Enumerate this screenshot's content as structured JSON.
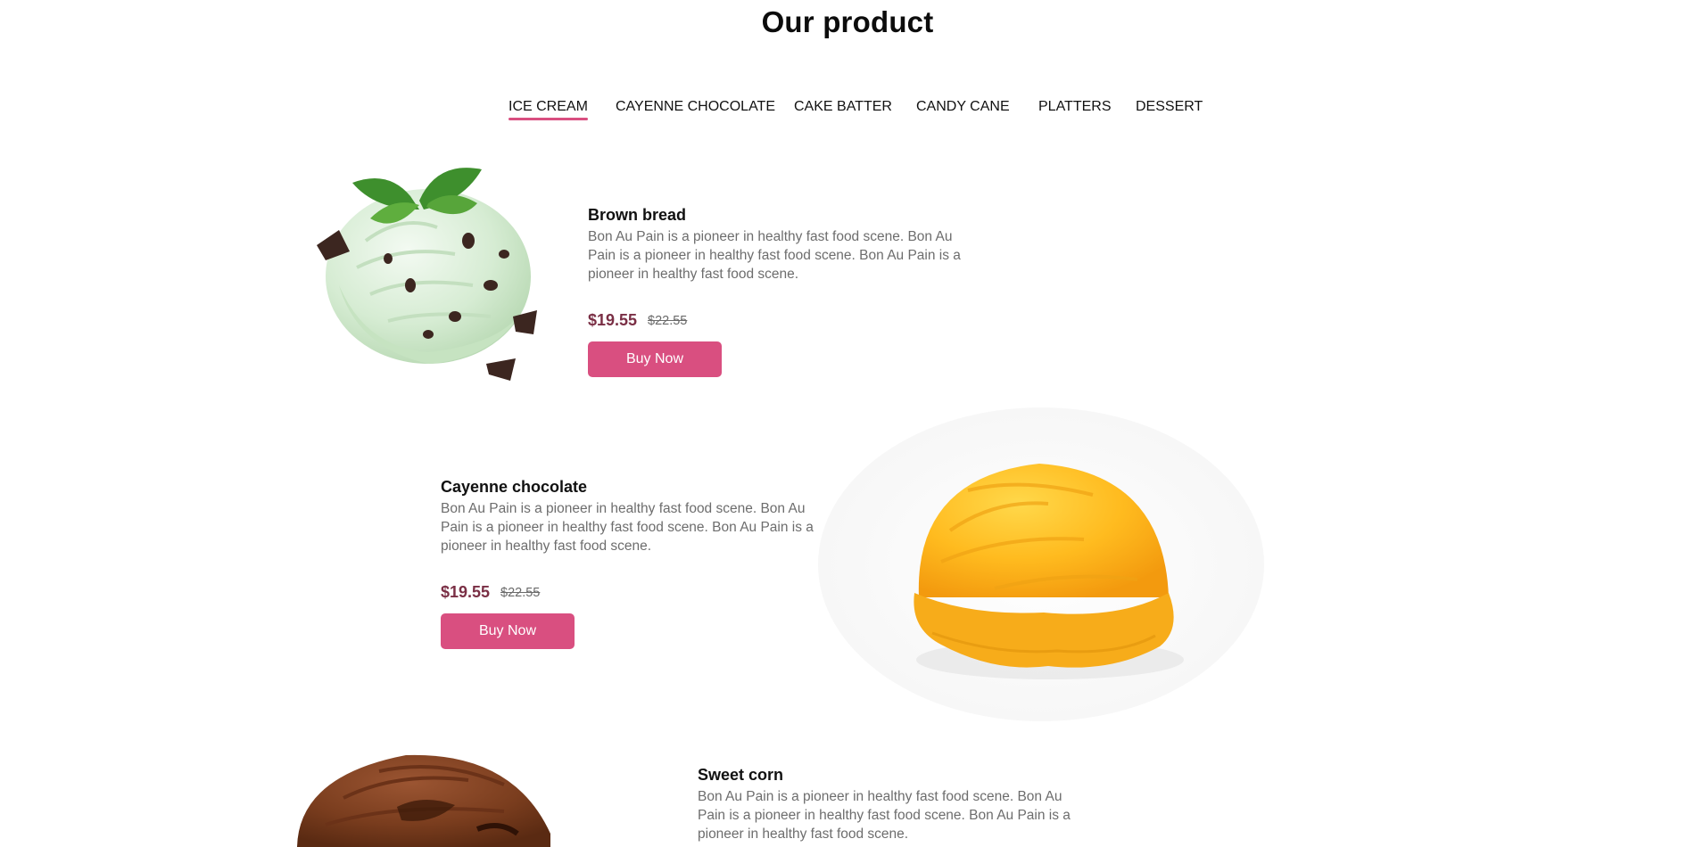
{
  "section": {
    "title": "Our product"
  },
  "tabs": [
    {
      "label": "ICE CREAM",
      "active": true
    },
    {
      "label": "CAYENNE CHOCOLATE",
      "active": false
    },
    {
      "label": "CAKE BATTER",
      "active": false
    },
    {
      "label": "CANDY CANE",
      "active": false
    },
    {
      "label": "PLATTERS",
      "active": false
    },
    {
      "label": "DESSERT",
      "active": false
    }
  ],
  "products": [
    {
      "name": "Brown bread",
      "description": "Bon Au Pain is a pioneer in healthy fast food scene. Bon Au Pain is a pioneer in healthy fast food scene. Bon Au Pain is a pioneer in healthy fast food scene.",
      "price": "$19.55",
      "old_price": "$22.55",
      "button_label": "Buy Now",
      "image": "mint-chocolate-chip-ice-cream-scoop"
    },
    {
      "name": "Cayenne chocolate",
      "description": "Bon Au Pain is a pioneer in healthy fast food scene. Bon Au Pain is a pioneer in healthy fast food scene. Bon Au Pain is a pioneer in healthy fast food scene.",
      "price": "$19.55",
      "old_price": "$22.55",
      "button_label": "Buy Now",
      "image": "mango-ice-cream-scoop"
    },
    {
      "name": "Sweet corn",
      "description": "Bon Au Pain is a pioneer in healthy fast food scene. Bon Au Pain is a pioneer in healthy fast food scene. Bon Au Pain is a pioneer in healthy fast food scene.",
      "image": "chocolate-ice-cream-scoop"
    }
  ],
  "colors": {
    "accent": "#d94f80",
    "price": "#7a2f45",
    "body_text": "#6d6d6d"
  }
}
